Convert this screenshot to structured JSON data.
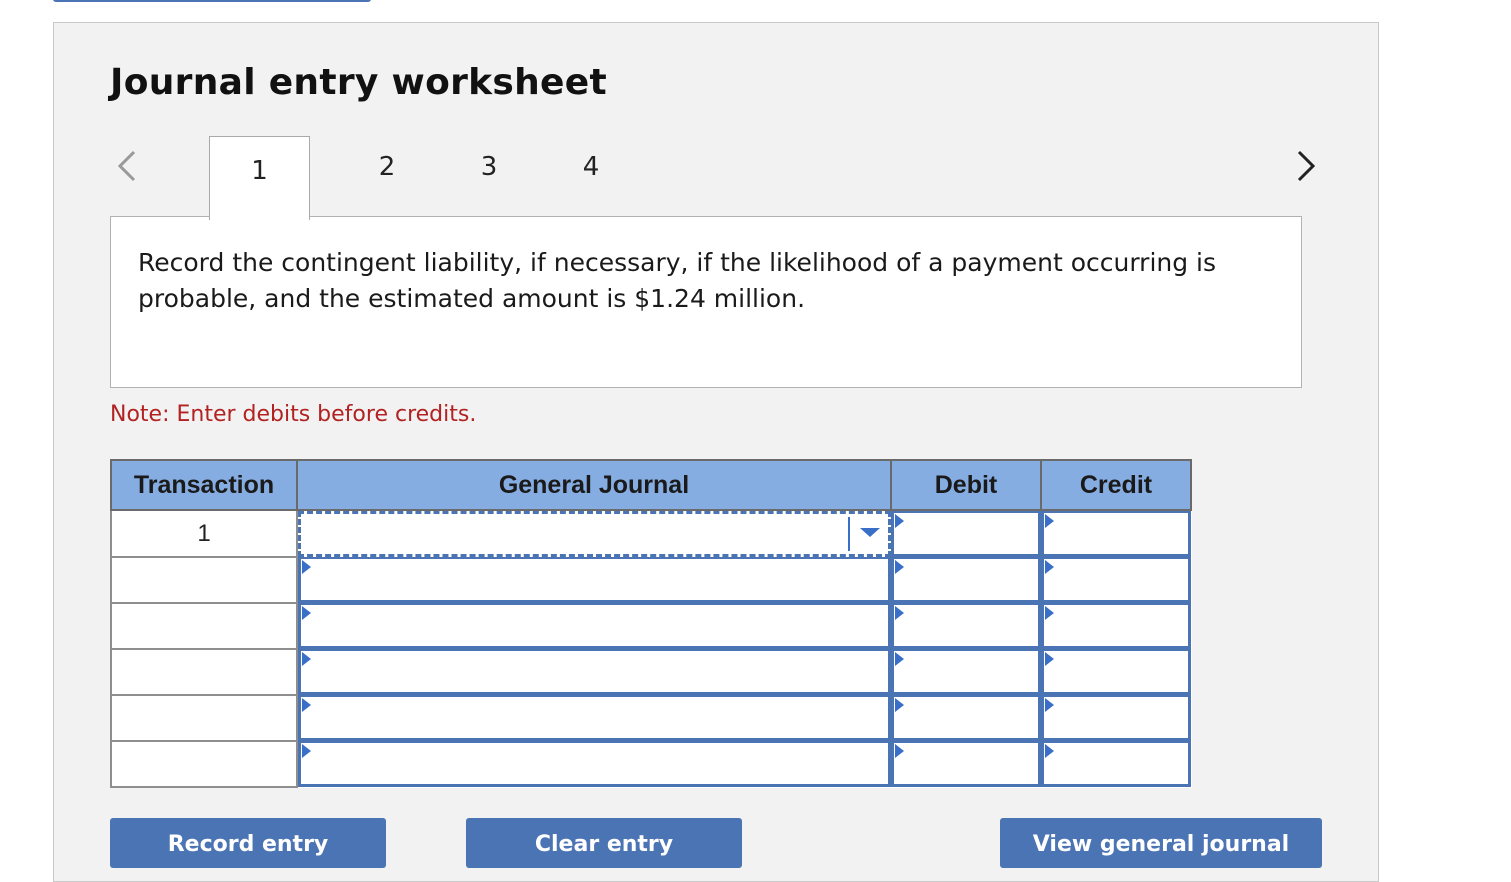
{
  "worksheet": {
    "title": "Journal entry worksheet",
    "tabs": [
      "1",
      "2",
      "3",
      "4"
    ],
    "active_tab": "1",
    "instruction": "Record the contingent liability, if necessary, if the likelihood of a payment occurring is probable, and the estimated amount is $1.24 million.",
    "note": "Note: Enter debits before credits."
  },
  "table": {
    "headers": {
      "transaction": "Transaction",
      "general_journal": "General Journal",
      "debit": "Debit",
      "credit": "Credit"
    },
    "rows": [
      {
        "transaction": "1",
        "account": "",
        "debit": "",
        "credit": ""
      },
      {
        "transaction": "",
        "account": "",
        "debit": "",
        "credit": ""
      },
      {
        "transaction": "",
        "account": "",
        "debit": "",
        "credit": ""
      },
      {
        "transaction": "",
        "account": "",
        "debit": "",
        "credit": ""
      },
      {
        "transaction": "",
        "account": "",
        "debit": "",
        "credit": ""
      },
      {
        "transaction": "",
        "account": "",
        "debit": "",
        "credit": ""
      }
    ]
  },
  "buttons": {
    "record": "Record entry",
    "clear": "Clear entry",
    "view": "View general journal"
  },
  "colors": {
    "panel_bg": "#f2f2f2",
    "header_bg": "#86ade2",
    "button_bg": "#4a74b4",
    "note_text": "#b22222"
  }
}
